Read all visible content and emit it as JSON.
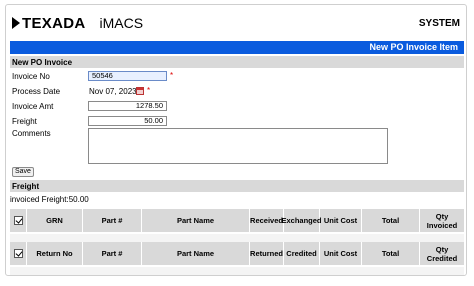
{
  "header": {
    "logo": "TEXADA",
    "app_name": "iMACS",
    "system_label": "SYSTEM"
  },
  "page_title": "New PO Invoice Item",
  "section_new_po": "New PO Invoice",
  "form": {
    "invoice_no_label": "Invoice No",
    "invoice_no_value": "50546",
    "process_date_label": "Process Date",
    "process_date_value": "Nov 07, 2023",
    "invoice_amt_label": "Invoice Amt",
    "invoice_amt_value": "1278.50",
    "freight_label": "Freight",
    "freight_value": "50.00",
    "comments_label": "Comments",
    "comments_value": "",
    "required_mark": "*",
    "save_label": "Save"
  },
  "section_freight": "Freight",
  "invoiced_freight_text": "invoiced Freight:50.00",
  "grn_table": {
    "columns": [
      "GRN",
      "Part #",
      "Part Name",
      "Received",
      "Exchanged",
      "Unit Cost",
      "Total",
      "Qty Invoiced"
    ]
  },
  "return_table": {
    "columns": [
      "Return No",
      "Part #",
      "Part Name",
      "Returned",
      "Credited",
      "Unit Cost",
      "Total",
      "Qty Credited"
    ]
  },
  "icons": {
    "calendar": "calendar-icon",
    "select_all": "checkbox-icon",
    "logo_mark": "chevron-right-icon"
  },
  "colors": {
    "title_bar": "#0a5bde",
    "section_bg": "#d9d9d9",
    "required": "#dd0000"
  }
}
